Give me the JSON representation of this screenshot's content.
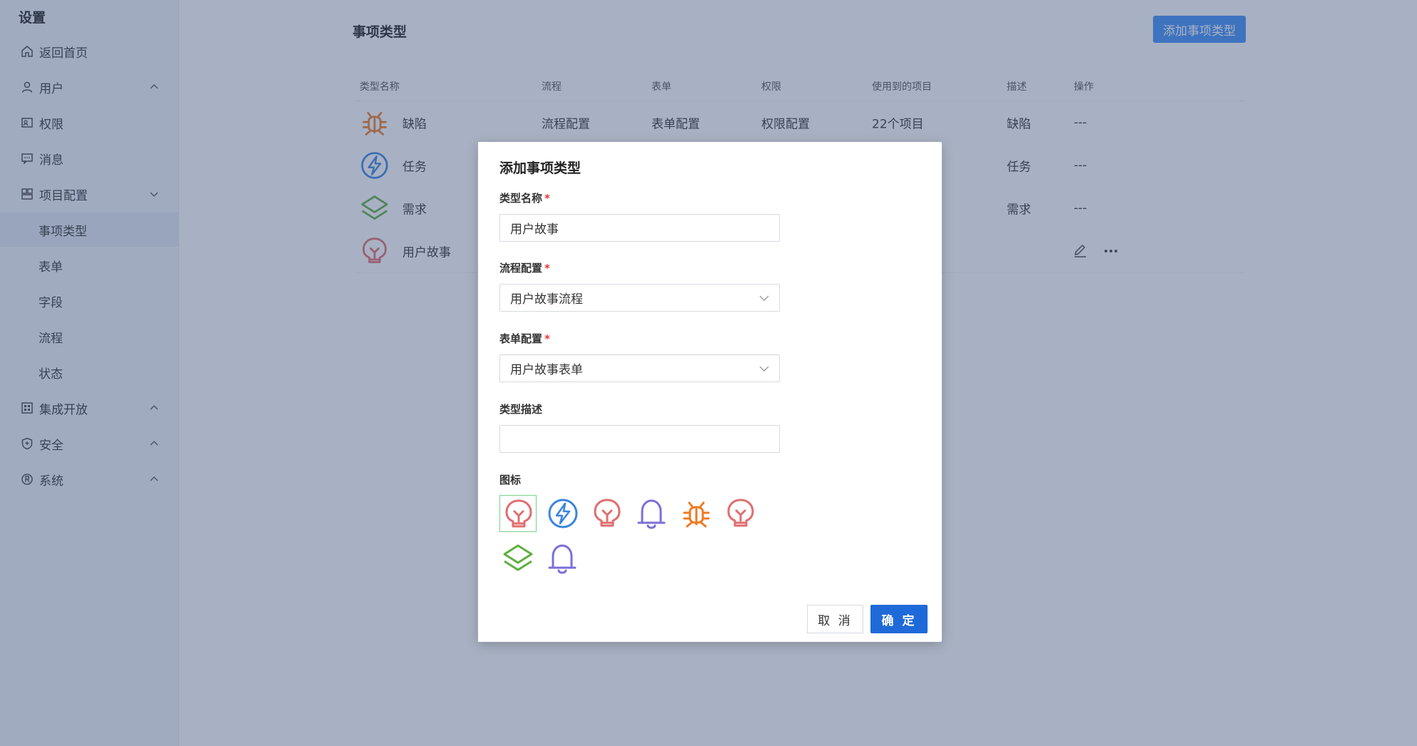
{
  "sidebar": {
    "title": "设置",
    "items": {
      "home": {
        "label": "返回首页",
        "icon": "home-icon"
      },
      "user": {
        "label": "用户",
        "icon": "user-icon"
      },
      "permission": {
        "label": "权限",
        "icon": "permission-icon"
      },
      "message": {
        "label": "消息",
        "icon": "message-icon"
      },
      "project_config": {
        "label": "项目配置",
        "icon": "project-config-icon"
      },
      "integration": {
        "label": "集成开放",
        "icon": "integration-icon"
      },
      "security": {
        "label": "安全",
        "icon": "shield-icon"
      },
      "system": {
        "label": "系统",
        "icon": "system-icon"
      }
    },
    "subitems": {
      "issue_type": "事项类型",
      "form": "表单",
      "field": "字段",
      "flow": "流程",
      "status": "状态"
    }
  },
  "main": {
    "title": "事项类型",
    "add_button": "添加事项类型",
    "columns": {
      "name": "类型名称",
      "flow": "流程",
      "form": "表单",
      "permission": "权限",
      "projects": "使用到的项目",
      "desc": "描述",
      "actions": "操作"
    },
    "rows": {
      "defect": {
        "name": "缺陷",
        "flow": "流程配置",
        "form": "表单配置",
        "permission": "权限配置",
        "projects": "22个项目",
        "desc": "缺陷",
        "actions": "---"
      },
      "task": {
        "name": "任务",
        "desc": "任务",
        "actions": "---"
      },
      "requirement": {
        "name": "需求",
        "desc": "需求",
        "actions": "---"
      },
      "story": {
        "name": "用户故事"
      }
    }
  },
  "modal": {
    "title": "添加事项类型",
    "name_label": "类型名称",
    "name_value": "用户故事",
    "flow_label": "流程配置",
    "flow_value": "用户故事流程",
    "form_label": "表单配置",
    "form_value": "用户故事表单",
    "desc_label": "类型描述",
    "desc_value": "",
    "icon_label": "图标",
    "required_mark": "*",
    "cancel": "取 消",
    "ok": "确 定"
  },
  "colors": {
    "primary": "#1f6ad9",
    "add_button": "#3e8ef7",
    "required": "#e33333",
    "icon_story": "#e06e6e",
    "icon_task": "#3a86de",
    "icon_bell": "#7b6fd8",
    "icon_bug": "#ee7a24",
    "icon_layers": "#5fae3f"
  }
}
